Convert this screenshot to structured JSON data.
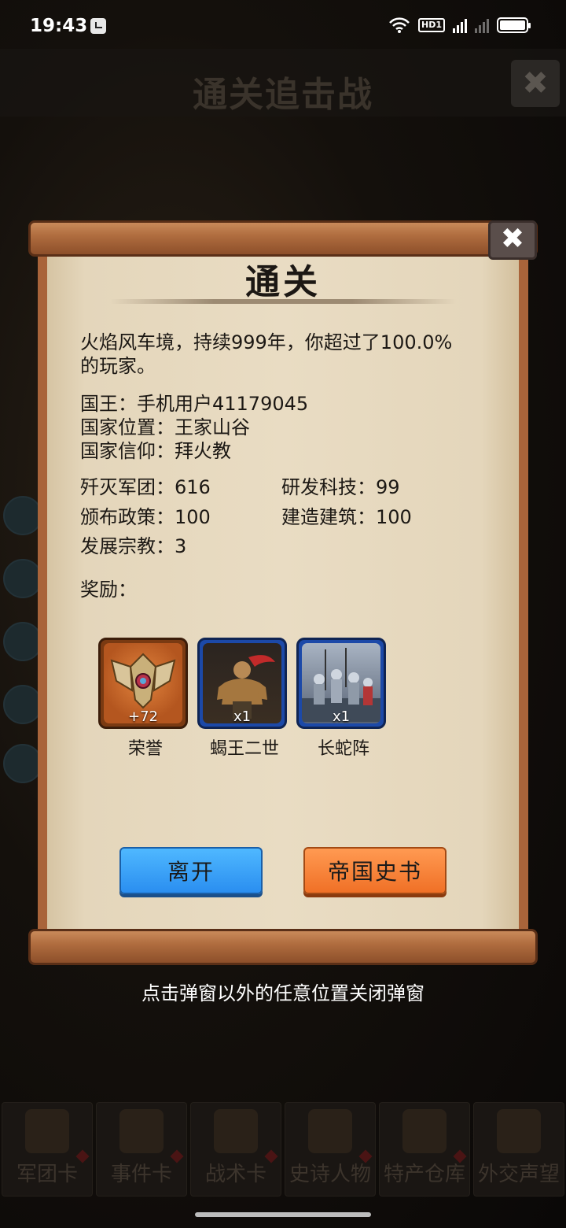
{
  "status_bar": {
    "time": "19:43",
    "network": "4G",
    "hd": "HD1"
  },
  "background": {
    "title": "通关追击战",
    "bottom_tabs": [
      "军团卡",
      "事件卡",
      "战术卡",
      "史诗人物",
      "特产仓库",
      "外交声望"
    ]
  },
  "dialog": {
    "title": "通关",
    "summary": "火焰风车境，持续999年，你超过了100.0%的玩家。",
    "king": "国王：手机用户41179045",
    "location": "国家位置：王家山谷",
    "faith": "国家信仰：拜火教",
    "stats": {
      "legions": "歼灭军团：616",
      "tech": "研发科技：99",
      "policies": "颁布政策：100",
      "buildings": "建造建筑：100",
      "religions": "发展宗教：3"
    },
    "reward_label": "奖励：",
    "rewards": [
      {
        "name": "荣誉",
        "qty": "+72",
        "icon": "honor-crest-icon"
      },
      {
        "name": "蝎王二世",
        "qty": "x1",
        "icon": "hero-portrait-icon"
      },
      {
        "name": "长蛇阵",
        "qty": "x1",
        "icon": "army-formation-icon"
      }
    ],
    "buttons": {
      "leave": "离开",
      "history": "帝国史书"
    },
    "close_icon": "close-icon"
  },
  "hint": "点击弹窗以外的任意位置关闭弹窗",
  "colors": {
    "leave": "#2a8ef0",
    "history": "#f07026",
    "parchment": "#e9dcc3",
    "rod": "#b06d3f"
  }
}
